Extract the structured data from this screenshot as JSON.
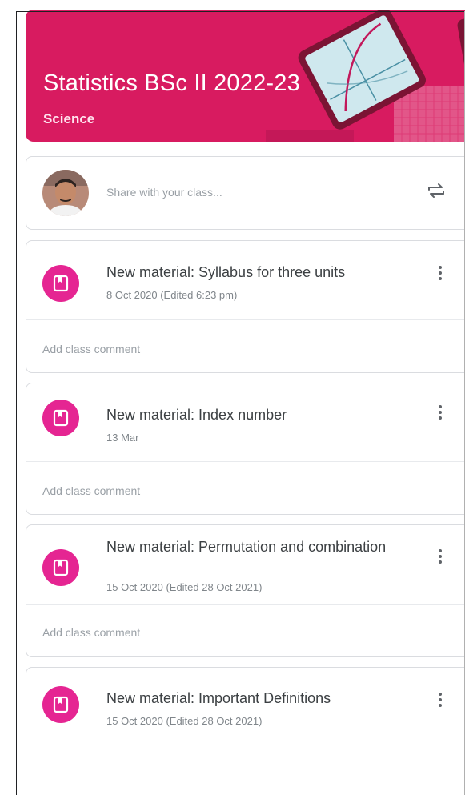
{
  "class": {
    "title": "Statistics BSc II 2022-23",
    "section": "Science",
    "theme_color": "#d81b60"
  },
  "share": {
    "placeholder": "Share with your class...",
    "icon": "repost-icon"
  },
  "posts": [
    {
      "title": "New material: Syllabus for three units",
      "date": "8 Oct 2020 (Edited 6:23 pm)",
      "comment_label": "Add class comment",
      "icon": "material-icon"
    },
    {
      "title": "New material: Index number",
      "date": "13 Mar",
      "comment_label": "Add class comment",
      "icon": "material-icon"
    },
    {
      "title": "New material: Permutation and combination",
      "date": "15 Oct 2020 (Edited 28 Oct 2021)",
      "comment_label": "Add class comment",
      "icon": "material-icon"
    },
    {
      "title": "New material: Important Definitions",
      "date": "15 Oct 2020 (Edited 28 Oct 2021)",
      "icon": "material-icon"
    }
  ],
  "colors": {
    "accent": "#e52592",
    "border": "#dadce0"
  }
}
